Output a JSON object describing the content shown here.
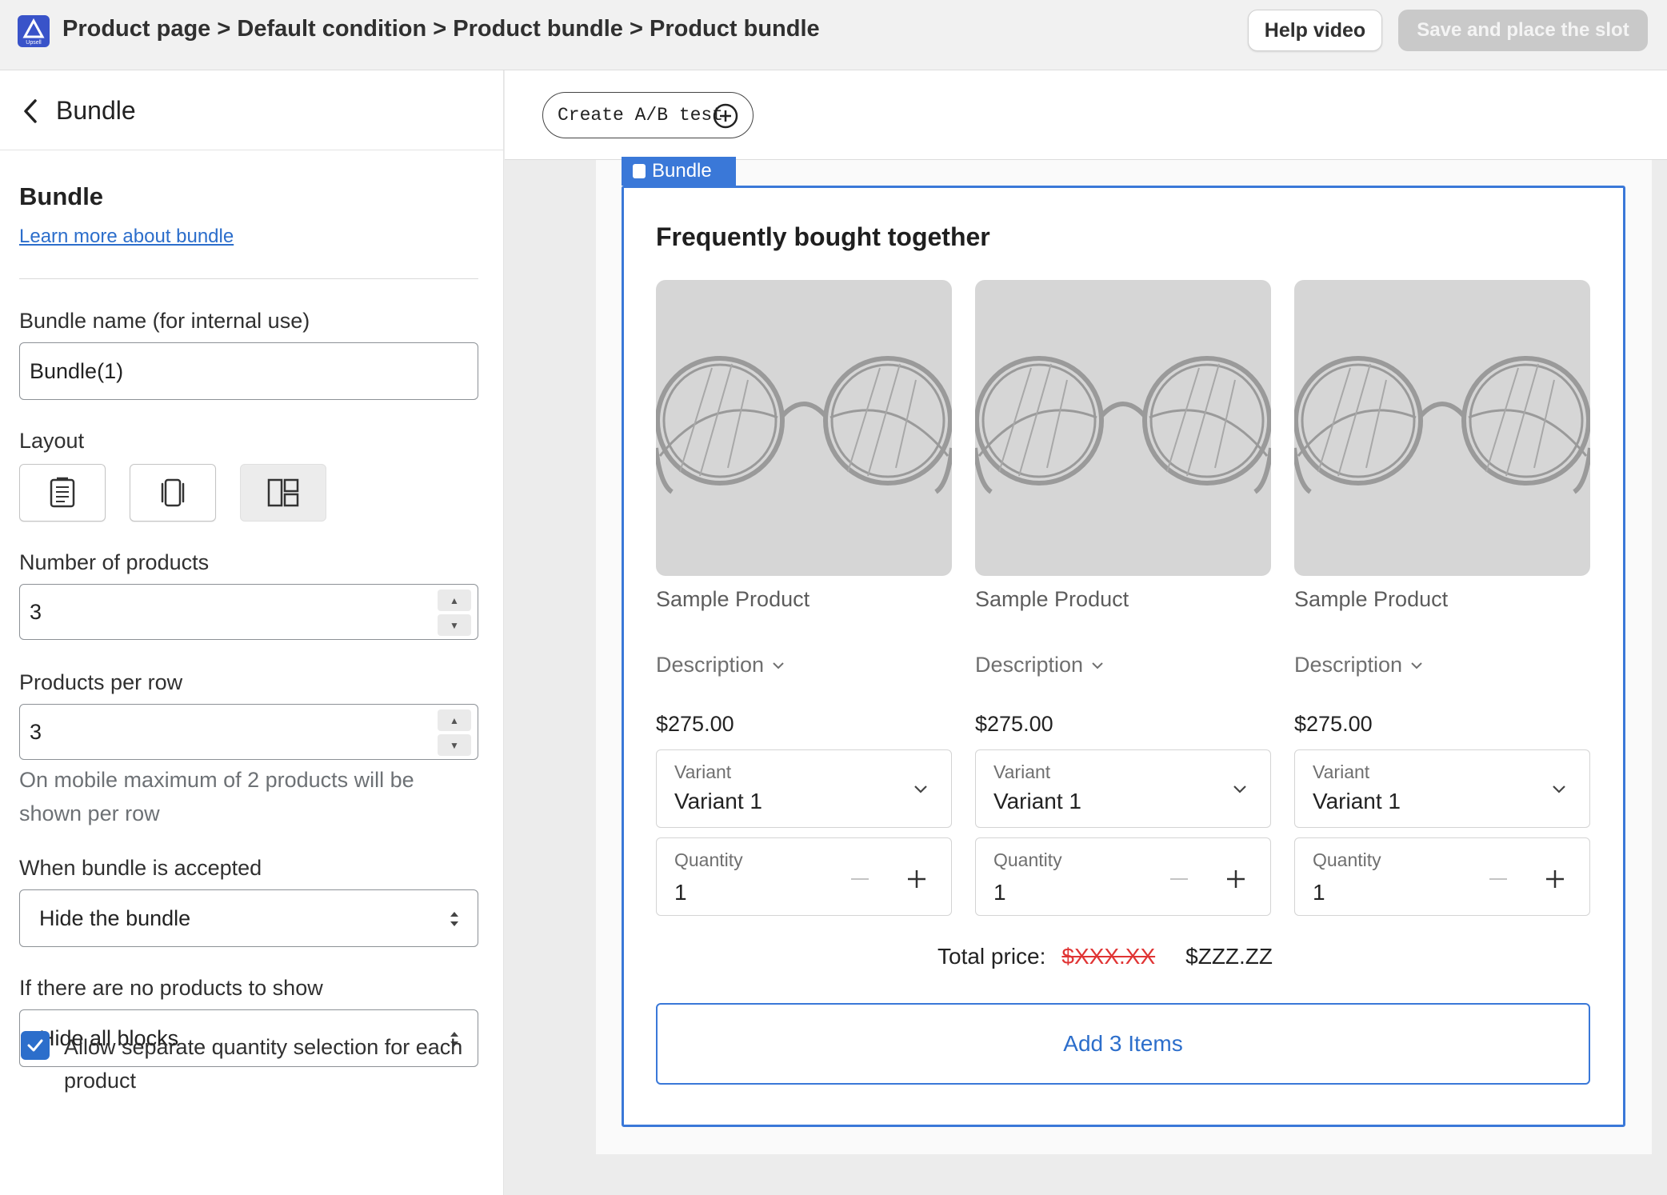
{
  "header": {
    "breadcrumb": [
      "Product page",
      "Default condition",
      "Product bundle",
      "Product bundle"
    ],
    "separator": ">",
    "help_label": "Help video",
    "save_label": "Save and place the slot",
    "logo_text": "Upsell"
  },
  "sidebar": {
    "back_title": "Bundle",
    "section_title": "Bundle",
    "learn_more": "Learn more about bundle",
    "bundle_name_label": "Bundle name (for internal use)",
    "bundle_name_value": "Bundle(1)",
    "layout_label": "Layout",
    "layout_options": [
      "list-layout-icon",
      "carousel-layout-icon",
      "grid-layout-icon"
    ],
    "layout_selected": 2,
    "num_products_label": "Number of products",
    "num_products_value": "3",
    "per_row_label": "Products per row",
    "per_row_value": "3",
    "per_row_help": "On mobile maximum of 2 products will be shown per row",
    "accepted_label": "When bundle is accepted",
    "accepted_value": "Hide the bundle",
    "no_products_label": "If there are no products to show",
    "no_products_value": "Hide all blocks",
    "allow_separate_label": "Allow separate quantity selection for each product",
    "allow_separate_checked": true
  },
  "preview": {
    "ab_test_label": "Create A/B test",
    "tag_label": "Bundle",
    "heading": "Frequently bought together",
    "products": [
      {
        "name": "Sample Product",
        "description": "Description",
        "price": "$275.00",
        "variant_label": "Variant",
        "variant_value": "Variant 1",
        "quantity_label": "Quantity",
        "quantity_value": "1"
      },
      {
        "name": "Sample Product",
        "description": "Description",
        "price": "$275.00",
        "variant_label": "Variant",
        "variant_value": "Variant 1",
        "quantity_label": "Quantity",
        "quantity_value": "1"
      },
      {
        "name": "Sample Product",
        "description": "Description",
        "price": "$275.00",
        "variant_label": "Variant",
        "variant_value": "Variant 1",
        "quantity_label": "Quantity",
        "quantity_value": "1"
      }
    ],
    "total_label": "Total price:",
    "total_old": "$XXX.XX",
    "total_new": "$ZZZ.ZZ",
    "add_button": "Add 3 Items"
  },
  "colors": {
    "accent": "#2c6ecb",
    "frame_blue": "#3a78d8",
    "strike_red": "#e03434",
    "logo_blue": "#3953c9"
  }
}
